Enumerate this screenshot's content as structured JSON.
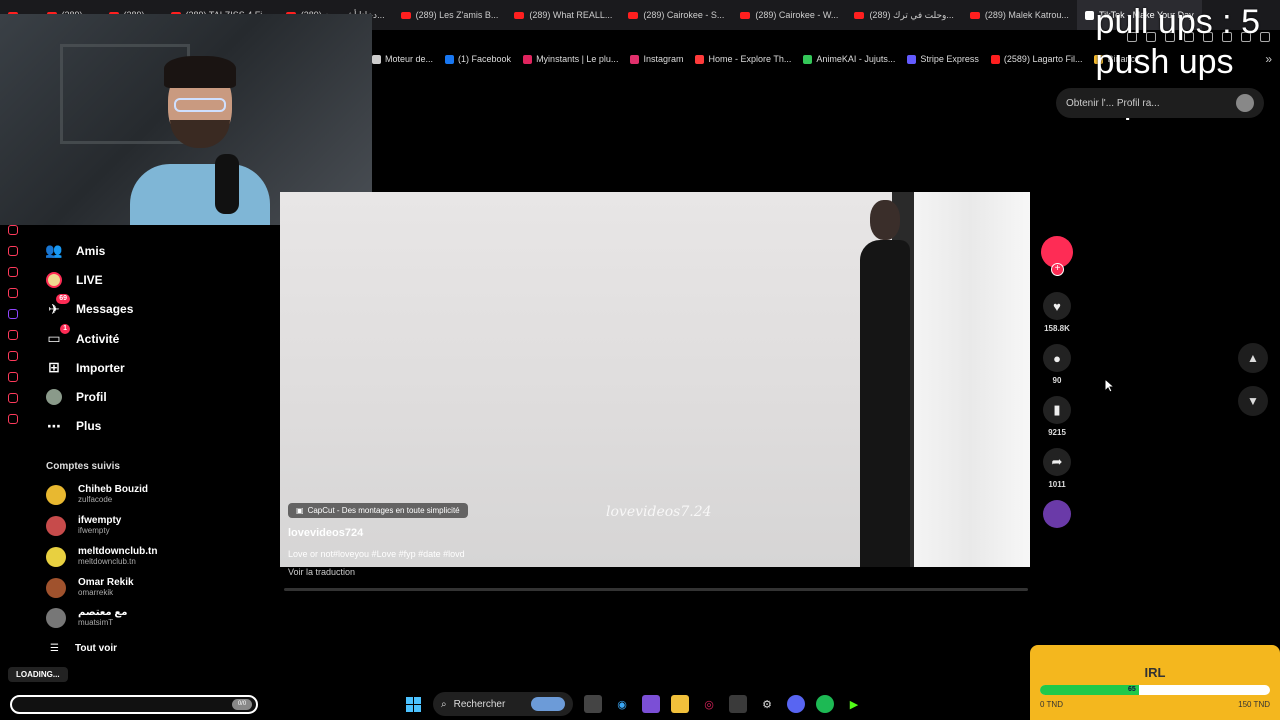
{
  "browser": {
    "tabs": [
      {
        "label": "..."
      },
      {
        "label": "(289) ..."
      },
      {
        "label": "(289) ..."
      },
      {
        "label": "(289) TALZISS 4 Fi..."
      },
      {
        "label": "(289) دخلنا أشهر مح..."
      },
      {
        "label": "(289) Les Z'amis B..."
      },
      {
        "label": "(289) What REALL..."
      },
      {
        "label": "(289) Cairokee - S..."
      },
      {
        "label": "(289) Cairokee - W..."
      },
      {
        "label": "(289) وحلت في ترك..."
      },
      {
        "label": "(289) Malek Katrou..."
      },
      {
        "label": "TikTok - Make Your Day"
      }
    ],
    "bookmarks": [
      {
        "label": "Moteur de...",
        "color": "#cccccc"
      },
      {
        "label": "(1) Facebook",
        "color": "#1877f2"
      },
      {
        "label": "Myinstants | Le plu...",
        "color": "#e0245e"
      },
      {
        "label": "Instagram",
        "color": "#e1306c"
      },
      {
        "label": "Home - Explore Th...",
        "color": "#ff3b3b"
      },
      {
        "label": "AnimeKAI - Jujuts...",
        "color": "#34c759"
      },
      {
        "label": "Stripe Express",
        "color": "#635bff"
      },
      {
        "label": "(2589) Lagarto Fil...",
        "color": "#ff1f1f"
      },
      {
        "label": "Binance",
        "color": "#f3ba2f"
      }
    ],
    "bookmarks_more": "»"
  },
  "overlay": {
    "line1": "pull ups : 5",
    "line2": "push ups",
    "line3": "squats"
  },
  "pill": {
    "text": "Obtenir l'... Profil ra..."
  },
  "sidebar": {
    "items": [
      {
        "label": "Amis",
        "icon": "friends-icon"
      },
      {
        "label": "LIVE",
        "icon": "live-icon"
      },
      {
        "label": "Messages",
        "icon": "messages-icon",
        "badge": "69"
      },
      {
        "label": "Activité",
        "icon": "activity-icon",
        "badge": "1"
      },
      {
        "label": "Importer",
        "icon": "upload-icon"
      },
      {
        "label": "Profil",
        "icon": "profile-icon"
      },
      {
        "label": "Plus",
        "icon": "more-icon"
      }
    ],
    "following_title": "Comptes suivis",
    "following": [
      {
        "name": "Chiheb Bouzid",
        "user": "zulfacode",
        "color": "#e8b830"
      },
      {
        "name": "ifwempty",
        "user": "ifwempty",
        "color": "#c74b4b"
      },
      {
        "name": "meltdownclub.tn",
        "user": "meltdownclub.tn",
        "color": "#e8d040"
      },
      {
        "name": "Omar Rekik",
        "user": "omarrekik",
        "color": "#a0522d"
      },
      {
        "name": "مع معتصم",
        "user": "muatsimT",
        "color": "#777777"
      }
    ],
    "see_all": "Tout voir"
  },
  "video": {
    "capcut": "CapCut - Des montages en toute simplicité",
    "watermark": "lovevideos7.24",
    "username": "lovevideos724",
    "description": "Love or not#loveyou #Love #fyp #date #lovd",
    "translate": "Voir la traduction"
  },
  "actions": {
    "likes": "158.8K",
    "comments": "90",
    "saves": "9215",
    "shares": "1011"
  },
  "goal": {
    "title": "IRL",
    "value": "65",
    "progress_fraction": 0.43,
    "min": "0 TND",
    "max": "150 TND"
  },
  "stream": {
    "loading": "LOADING...",
    "toggle": "0/0"
  },
  "taskbar": {
    "search": "Rechercher"
  }
}
